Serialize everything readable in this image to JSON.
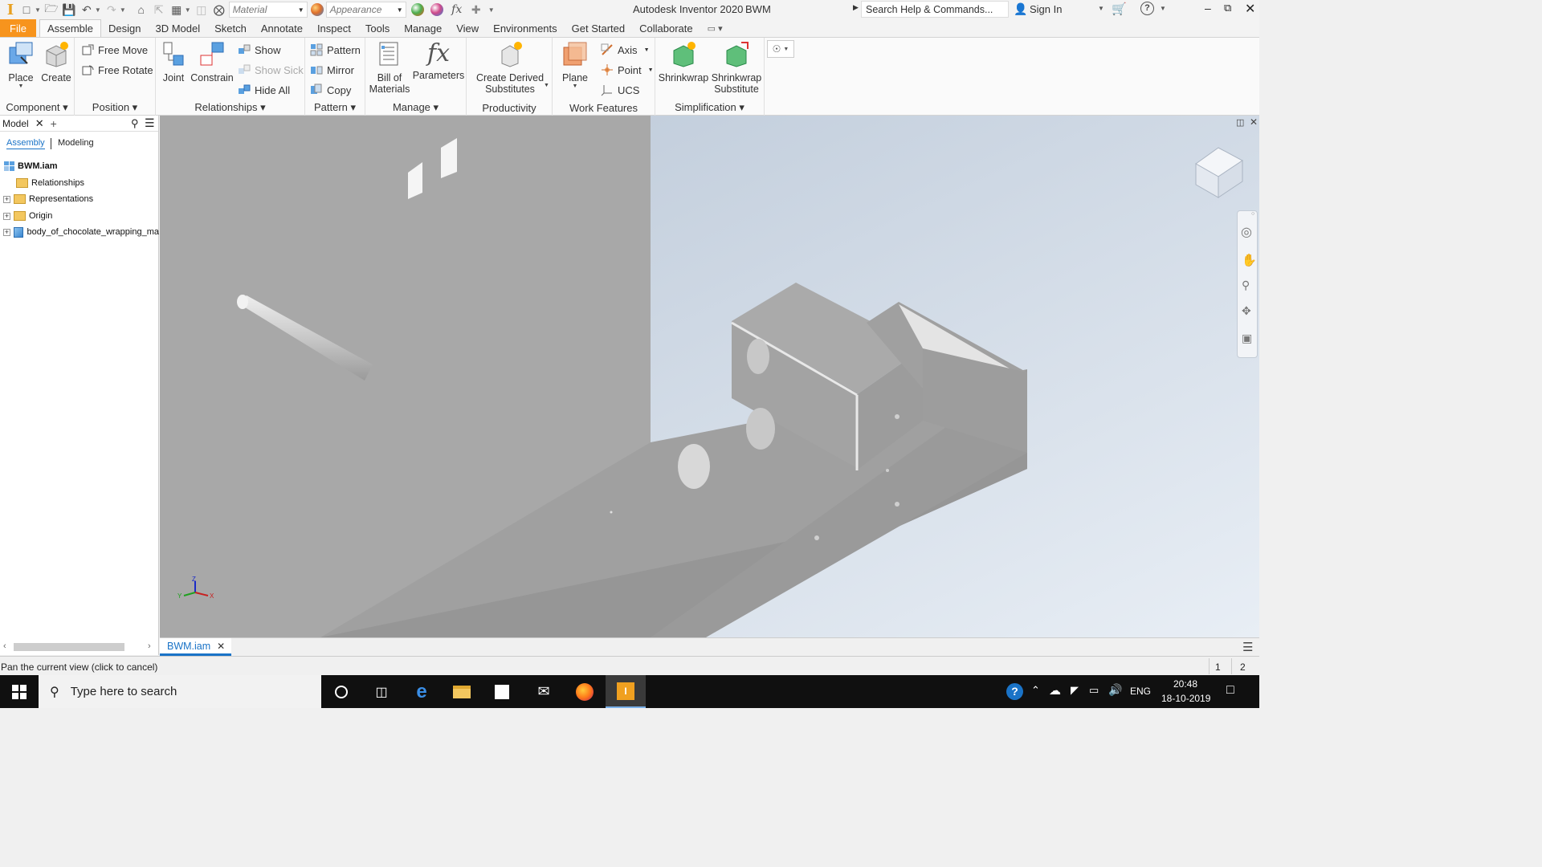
{
  "titlebar": {
    "app_title": "Autodesk Inventor 2020",
    "doc_title": "BWM",
    "material_placeholder": "Material",
    "appearance_placeholder": "Appearance",
    "search_placeholder": "Search Help & Commands...",
    "sign_in": "Sign In"
  },
  "tabs": [
    "File",
    "Assemble",
    "Design",
    "3D Model",
    "Sketch",
    "Annotate",
    "Inspect",
    "Tools",
    "Manage",
    "View",
    "Environments",
    "Get Started",
    "Collaborate"
  ],
  "ribbon": {
    "component": {
      "label": "Component",
      "place": "Place",
      "create": "Create"
    },
    "position": {
      "label": "Position",
      "free_move": "Free Move",
      "free_rotate": "Free Rotate"
    },
    "relationships": {
      "label": "Relationships",
      "joint": "Joint",
      "constrain": "Constrain",
      "show": "Show",
      "show_sick": "Show Sick",
      "hide_all": "Hide All"
    },
    "pattern": {
      "label": "Pattern",
      "pattern": "Pattern",
      "mirror": "Mirror",
      "copy": "Copy"
    },
    "manage": {
      "label": "Manage",
      "bom_line1": "Bill of",
      "bom_line2": "Materials",
      "parameters": "Parameters"
    },
    "productivity": {
      "label": "Productivity",
      "cds_line1": "Create Derived",
      "cds_line2": "Substitutes"
    },
    "work_features": {
      "label": "Work Features",
      "plane": "Plane",
      "axis": "Axis",
      "point": "Point",
      "ucs": "UCS"
    },
    "simplification": {
      "label": "Simplification",
      "shrinkwrap": "Shrinkwrap",
      "sws_line1": "Shrinkwrap",
      "sws_line2": "Substitute"
    }
  },
  "browser": {
    "title": "Model",
    "tab_assembly": "Assembly",
    "tab_modeling": "Modeling",
    "root": "BWM.iam",
    "items": [
      {
        "label": "Relationships",
        "expandable": false
      },
      {
        "label": "Representations",
        "expandable": true
      },
      {
        "label": "Origin",
        "expandable": true
      },
      {
        "label": "body_of_chocolate_wrapping_ma",
        "expandable": true
      }
    ]
  },
  "document_tab": "BWM.iam",
  "status": {
    "message": "Pan the current view (click to cancel)",
    "num1": "1",
    "num2": "2"
  },
  "taskbar": {
    "search_placeholder": "Type here to search",
    "lang": "ENG",
    "time": "20:48",
    "date": "18-10-2019"
  },
  "colors": {
    "file_tab": "#f7941d",
    "viewport_bg_light": "#d6dfe9",
    "model_gray": "#a3a3a3",
    "taskbar": "#101010",
    "active_tab_blue": "#1a73c7"
  }
}
